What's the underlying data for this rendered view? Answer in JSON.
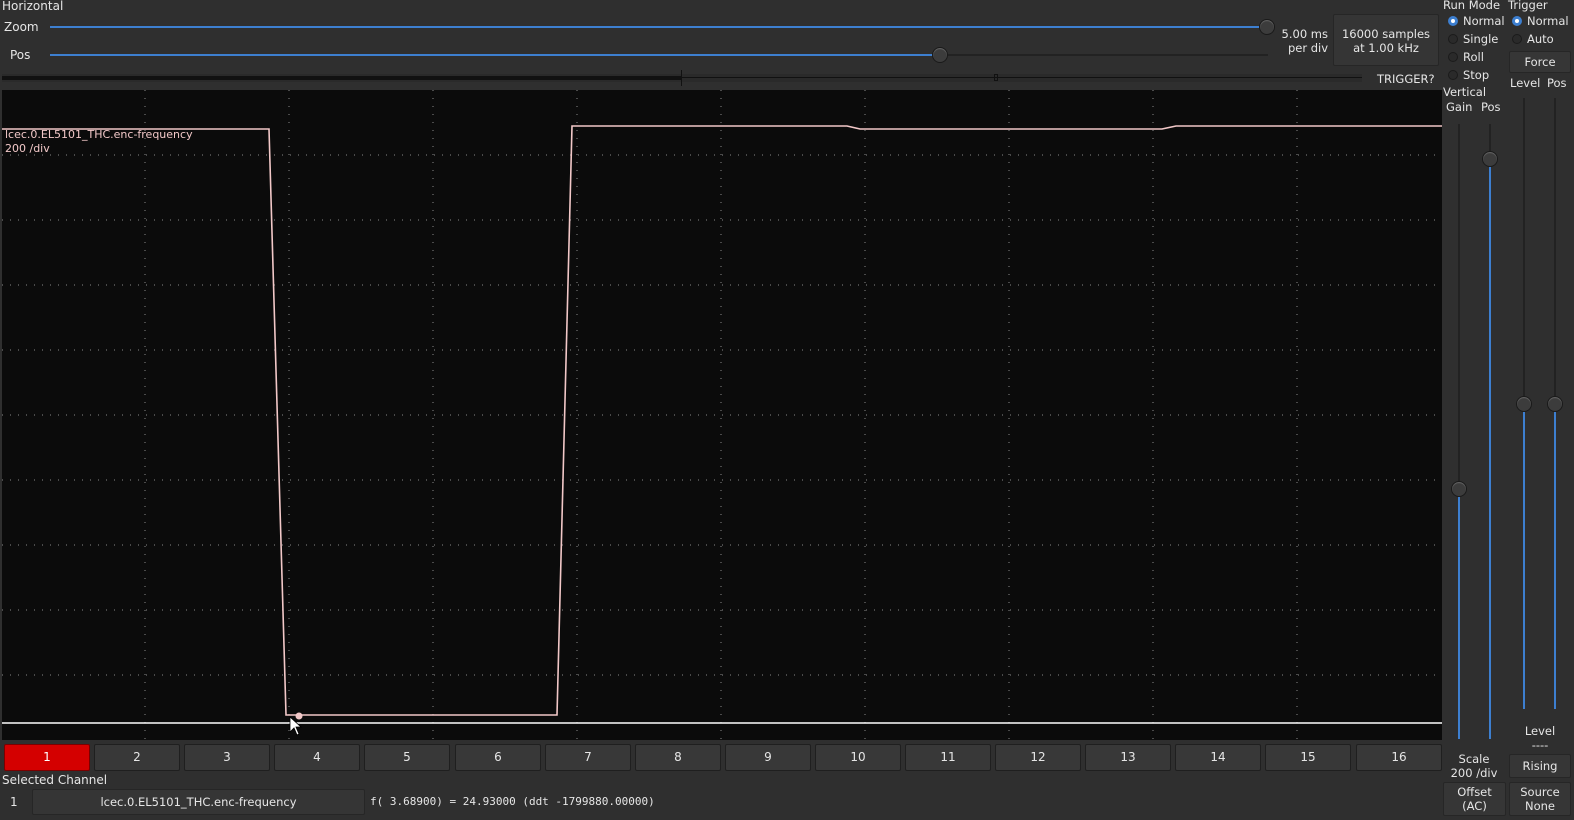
{
  "horizontal": {
    "title": "Horizontal",
    "zoom_label": "Zoom",
    "pos_label": "Pos",
    "timebase_line1": "5.00 ms",
    "timebase_line2": "per div",
    "samples_line1": "16000 samples",
    "samples_line2": "at 1.00 kHz",
    "trigger_status": "TRIGGER?",
    "zoom_level": 1.0,
    "pos_level": 0.73
  },
  "run_mode": {
    "title": "Run Mode",
    "options": [
      "Normal",
      "Single",
      "Roll",
      "Stop"
    ],
    "selected": "Normal"
  },
  "trigger": {
    "title": "Trigger",
    "options": [
      "Normal",
      "Auto"
    ],
    "selected": "Normal",
    "force_label": "Force",
    "level_label": "Level",
    "pos_label": "Pos",
    "level_title": "Level",
    "level_value": "----",
    "edge_label": "Rising",
    "source_line1": "Source",
    "source_line2": "None"
  },
  "vertical": {
    "title": "Vertical",
    "gain_label": "Gain",
    "pos_label": "Pos",
    "scale_line1": "Scale",
    "scale_line2": "200 /div",
    "offset_line1": "Offset",
    "offset_line2": "(AC)"
  },
  "scope": {
    "channel_name": "lcec.0.EL5101_THC.enc-frequency",
    "channel_scale": "200 /div",
    "trace_color": "#f2c8c8"
  },
  "channels": [
    "1",
    "2",
    "3",
    "4",
    "5",
    "6",
    "7",
    "8",
    "9",
    "10",
    "11",
    "12",
    "13",
    "14",
    "15",
    "16"
  ],
  "selected_channel_index": 0,
  "selected_channel": {
    "title": "Selected Channel",
    "number": "1",
    "name": "lcec.0.EL5101_THC.enc-frequency",
    "readout": "f( 3.68900) =  24.93000 (ddt -1799880.00000)"
  },
  "colors": {
    "accent": "#3d7fd0",
    "selected_channel": "#d40000",
    "scope_bg": "#0b0b0b"
  }
}
